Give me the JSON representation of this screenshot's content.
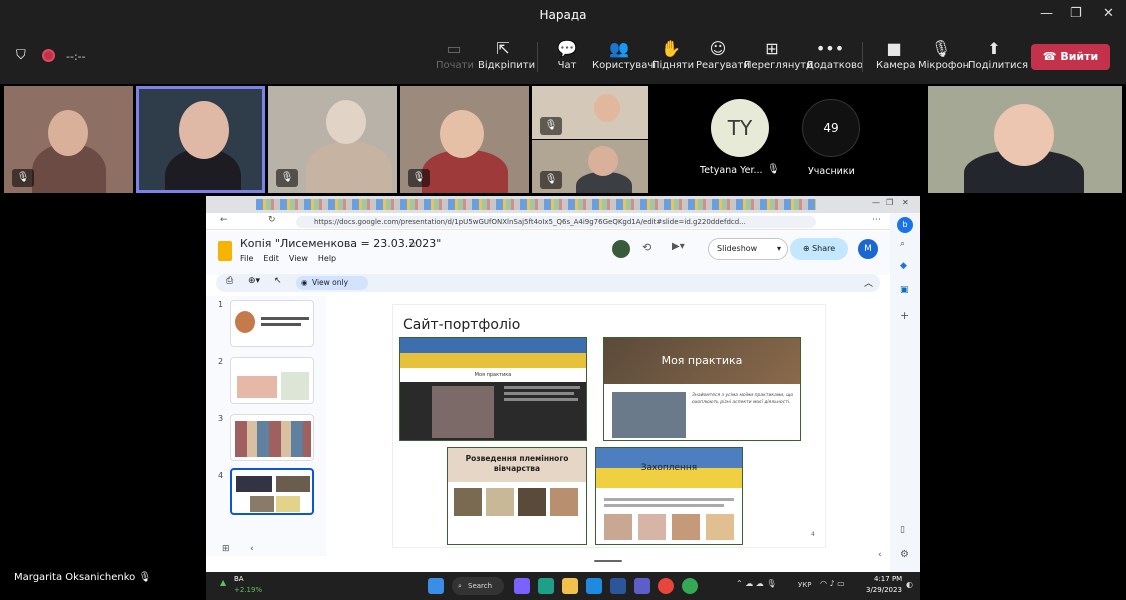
{
  "window": {
    "title": "Нарада",
    "timer": "--:--"
  },
  "toolbar": {
    "items": [
      {
        "label": "Почати",
        "icon": "present-icon"
      },
      {
        "label": "Відкріпити",
        "icon": "unpin-icon"
      },
      {
        "label": "Чат",
        "icon": "chat-icon"
      },
      {
        "label": "Користувачі",
        "icon": "people-icon"
      },
      {
        "label": "Підняти",
        "icon": "raise-hand-icon"
      },
      {
        "label": "Реагувати",
        "icon": "react-icon"
      },
      {
        "label": "Переглянути",
        "icon": "view-icon"
      },
      {
        "label": "Додатково",
        "icon": "more-icon"
      },
      {
        "label": "Камера",
        "icon": "camera-icon"
      },
      {
        "label": "Мікрофон",
        "icon": "mic-off-icon"
      },
      {
        "label": "Поділитися",
        "icon": "share-screen-icon"
      }
    ],
    "leave_label": "Вийти"
  },
  "participants": {
    "avatar_initials": "TY",
    "avatar_name": "Tetyana Yer...",
    "count": "49",
    "count_label": "Учасники",
    "presenter_name": "Margarita Oksanichenko"
  },
  "browser": {
    "url": "https://docs.google.com/presentation/d/1pU5wGUfONXlnSaj5ft4oIx5_Q6s_A4i9g76GeQKgd1A/edit#slide=id.g220ddefdcd..."
  },
  "slides_app": {
    "doc_title": "Копія \"Лисеменкова = 23.03.2023\"",
    "menus": [
      "File",
      "Edit",
      "View",
      "Help"
    ],
    "slideshow_label": "Slideshow",
    "share_label": "Share",
    "account_initial": "M",
    "view_only_label": "View only",
    "thumb_numbers": [
      "1",
      "2",
      "3",
      "4"
    ],
    "current_slide": {
      "title": "Сайт-портфоліо",
      "page_number": "4",
      "sites": [
        {
          "heading": "Моя практика"
        },
        {
          "heading": "Моя практика",
          "caption": "Знайомтеся з усіма моїми практиками, що охоплюють різні аспекти моєї діяльності."
        },
        {
          "heading": "Розведення племінного вівчарства"
        },
        {
          "heading": "Захоплення"
        }
      ]
    }
  },
  "taskbar": {
    "ticker": "BA",
    "ticker_change": "+2.19%",
    "search_label": "Search",
    "lang": "УКР",
    "time": "4:17 PM",
    "date": "3/29/2023"
  }
}
